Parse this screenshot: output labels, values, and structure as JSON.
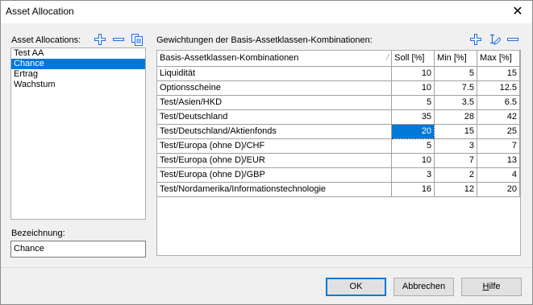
{
  "window": {
    "title": "Asset Allocation",
    "close_glyph": "✕"
  },
  "left": {
    "label": "Asset Allocations:",
    "items": [
      "Test AA",
      "Chance",
      "Ertrag",
      "Wachstum"
    ],
    "selected_index": 1,
    "icons": [
      "add-icon",
      "remove-icon",
      "copy-icon"
    ]
  },
  "name_field": {
    "label": "Bezeichnung:",
    "value": "Chance"
  },
  "weights": {
    "label": "Gewichtungen der Basis-Assetklassen-Kombinationen:",
    "icons": [
      "add-icon",
      "edit-icon",
      "remove-icon"
    ],
    "columns": [
      "Basis-Assetklassen-Kombinationen",
      "Soll [%]",
      "Min [%]",
      "Max [%]"
    ],
    "rows": [
      [
        "Liquidität",
        "10",
        "5",
        "15"
      ],
      [
        "Optionsscheine",
        "10",
        "7.5",
        "12.5"
      ],
      [
        "Test/Asien/HKD",
        "5",
        "3.5",
        "6.5"
      ],
      [
        "Test/Deutschland",
        "35",
        "28",
        "42"
      ],
      [
        "Test/Deutschland/Aktienfonds",
        "20",
        "15",
        "25"
      ],
      [
        "Test/Europa (ohne D)/CHF",
        "5",
        "3",
        "7"
      ],
      [
        "Test/Europa (ohne D)/EUR",
        "10",
        "7",
        "13"
      ],
      [
        "Test/Europa (ohne D)/GBP",
        "3",
        "2",
        "4"
      ],
      [
        "Test/Nordamerika/Informationstechnologie",
        "16",
        "12",
        "20"
      ]
    ],
    "selected_cell": {
      "row": 4,
      "col": 1
    }
  },
  "buttons": {
    "ok": "OK",
    "cancel": "Abbrechen",
    "help_first": "H",
    "help_rest": "ilfe"
  },
  "colors": {
    "selection": "#0078d7",
    "icon_blue": "#1e6fd9"
  }
}
